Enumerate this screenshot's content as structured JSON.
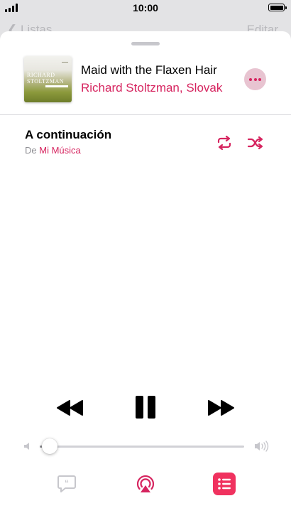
{
  "status_bar": {
    "time": "10:00"
  },
  "background_nav": {
    "back_label": "Listas",
    "edit_label": "Editar"
  },
  "now_playing": {
    "artwork_line1": "RICHARD",
    "artwork_line2": "STOLTZMAN",
    "title": "Maid with the Flaxen Hair",
    "artist": "Richard Stoltzman, Slovak Radio Symphony Orchestra"
  },
  "up_next": {
    "heading": "A continuación",
    "from_prefix": "De",
    "source": "Mi Música"
  },
  "volume": {
    "level": 0.05
  },
  "colors": {
    "accent": "#d6245f",
    "queue_active": "#f0325f",
    "sheet_bg": "#ffffff",
    "backdrop": "#e3e3e5"
  },
  "icons": {
    "more": "ellipsis-icon",
    "repeat": "repeat-icon",
    "shuffle": "shuffle-icon",
    "rewind": "rewind-icon",
    "pause": "pause-icon",
    "forward": "fast-forward-icon",
    "lyrics": "lyrics-icon",
    "airplay": "airplay-icon",
    "queue": "queue-list-icon"
  }
}
